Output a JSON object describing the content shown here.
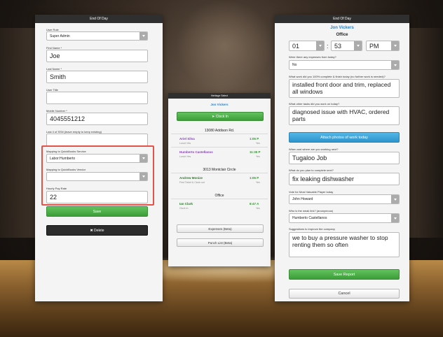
{
  "screen1": {
    "title": "End Of Day",
    "user_role": {
      "label": "User Role",
      "value": "Super Admin"
    },
    "first_name": {
      "label": "First Name *",
      "value": "Joe"
    },
    "last_name": {
      "label": "Last Name *",
      "value": "Smith"
    },
    "user_title": {
      "label": "User Title",
      "value": ""
    },
    "mobile": {
      "label": "Mobile Number *",
      "value": "4045551212"
    },
    "ssn": {
      "label": "Last 4 of SSN (leave empty to keep existing)",
      "value": ""
    },
    "qb_service": {
      "label": "Mapping to QuickBooks Service",
      "value": "Labor:Humberto"
    },
    "qb_vendor": {
      "label": "Mapping to QuickBooks Vendor",
      "value": ""
    },
    "pay_rate": {
      "label": "Hourly Pay Rate",
      "value": "22"
    },
    "save_label": "Save",
    "delete_label": "✖ Delete"
  },
  "screen2": {
    "title": "Heritage Select",
    "user": "Jon Vickers",
    "clock_in_label": "➤ Clock In",
    "locations": [
      {
        "name": "13080 Addison Rd.",
        "entries": [
          {
            "name": "Ariel Silva",
            "sub": "Lunch  Yes",
            "time": "1:05 P",
            "tag": "Yes"
          },
          {
            "name": "Humberto Castellanos",
            "sub": "Lunch  Yes",
            "time": "11:35 P",
            "tag": "Yes"
          }
        ]
      },
      {
        "name": "3013 Montclair Circle",
        "entries": [
          {
            "name": "Andrew Monize",
            "sub": "First Ticket & Clock out",
            "time": "1:05 P",
            "tag": "Yes"
          }
        ]
      },
      {
        "name": "Office",
        "entries": [
          {
            "name": "Ian Clark",
            "sub": "Clock in",
            "time": "8:47 A",
            "tag": "Yes"
          }
        ]
      }
    ],
    "expenses_label": "Expenses (Beta)",
    "punch_list_label": "Punch List (Beta)"
  },
  "screen3": {
    "title": "End Of Day",
    "user": "Jon Vickers",
    "location": "Office",
    "hour": "01",
    "minute": "53",
    "ampm": "PM",
    "q_expenses": {
      "label": "Were there any expenses from today?",
      "value": "No"
    },
    "q_work": {
      "label": "What work did you 100% complete & finish today (no further work is needed)?",
      "value": "installed front door and trim, replaced all windows"
    },
    "q_other": {
      "label": "What other tasks did you work on today?",
      "value": "diagnosed issue with HVAC, ordered parts"
    },
    "attach_label": "Attach photos of work today",
    "q_where": {
      "label": "When and where are you working next?",
      "value": "Tugaloo Job"
    },
    "q_plan": {
      "label": "What do you plan to complete next?",
      "value": "fix leaking dishwasher"
    },
    "q_mvp": {
      "label": "Vote for Most Valuable Player today",
      "value": "John Howard"
    },
    "q_weak": {
      "label": "Who is the weak link? (anonymous)",
      "value": "Humberto Castellanos"
    },
    "q_suggest": {
      "label": "Suggestions to improve the company",
      "value": "we to buy a pressure washer to stop renting them so often"
    },
    "save_label": "Save Report",
    "cancel_label": "Cancel"
  },
  "colors": {
    "accent_green": "#3d9e39",
    "accent_blue": "#2f94cc",
    "link_blue": "#2a7fc4",
    "name_purple": "#8a3fbf",
    "highlight_red": "#e35348"
  }
}
